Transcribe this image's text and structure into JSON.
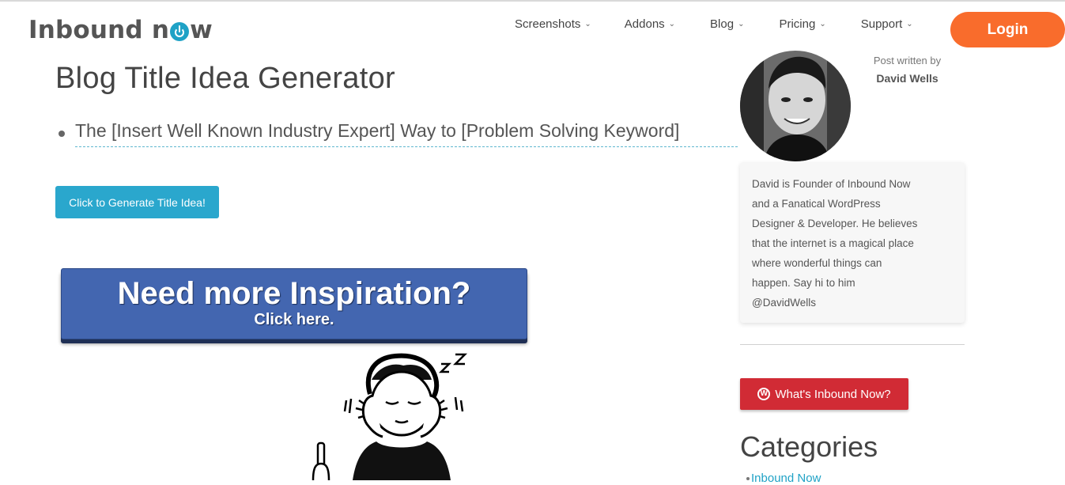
{
  "header": {
    "logo_text_1": "Inbound n",
    "logo_text_2": "w",
    "nav": [
      {
        "label": "Screenshots"
      },
      {
        "label": "Addons"
      },
      {
        "label": "Blog"
      },
      {
        "label": "Pricing"
      },
      {
        "label": "Support"
      }
    ],
    "login_label": "Login"
  },
  "main": {
    "title": "Blog Title Idea Generator",
    "title_idea": "The [Insert Well Known Industry Expert] Way to [Problem Solving Keyword]",
    "generate_button": "Click to Generate Title Idea!",
    "inspiration_main": "Need more Inspiration?",
    "inspiration_sub": "Click here."
  },
  "sidebar": {
    "post_written_by": "Post written by",
    "author_name": "David Wells",
    "bio": "David is Founder of Inbound Now and a Fanatical WordPress Designer & Developer. He believes that the internet is a magical place where wonderful things can happen. Say hi to him @DavidWells",
    "whats_inbound_button": "What's Inbound Now?",
    "categories_heading": "Categories",
    "categories_first_item": "Inbound Now"
  },
  "colors": {
    "accent_orange": "#f96c2c",
    "accent_blue": "#2aa7cd",
    "inspire_blue": "#4366b0",
    "wp_red": "#d12b35"
  },
  "icons": [
    "chevron-down-icon",
    "power-icon",
    "wordpress-icon"
  ]
}
